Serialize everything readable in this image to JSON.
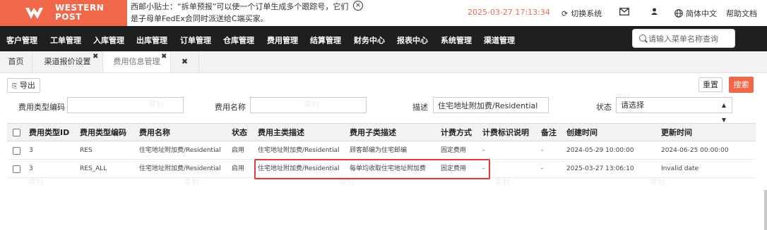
{
  "brand": {
    "line1": "WESTERN",
    "line2": "POST",
    "accent": "#f0674a"
  },
  "tip": {
    "text": "西邮小贴士：“拆单预报”可以使一个订单生成多个跟踪号，它们是子母单FedEx会同时派送给C端买家。"
  },
  "header": {
    "datetime": "2025-03-27 17:13:34",
    "switch_system": "切换系统",
    "language": "简体中文",
    "help": "帮助文档"
  },
  "nav": {
    "items": [
      "客户管理",
      "工单管理",
      "入库管理",
      "出库管理",
      "订单管理",
      "仓库管理",
      "费用管理",
      "结算管理",
      "财务中心",
      "报表中心",
      "系统管理",
      "渠道管理"
    ],
    "search_placeholder": "请输入菜单名称查询"
  },
  "tabs": [
    "首页",
    "渠道报价设置",
    "费用信息管理"
  ],
  "toolbar": {
    "export": "导出",
    "reset": "重置",
    "search": "搜索"
  },
  "filters": {
    "fee_type_code_label": "费用类型编码",
    "fee_type_code_value": "",
    "fee_name_label": "费用名称",
    "fee_name_value": "",
    "desc_label": "描述",
    "desc_value": "住宅地址附加费/Residential",
    "status_label": "状态",
    "status_value": "请选择"
  },
  "table": {
    "columns": [
      "费用类型ID",
      "费用类型编码",
      "费用名称",
      "状态",
      "费用主类描述",
      "费用子类描述",
      "计费方式",
      "计费标识说明",
      "备注",
      "创建时间",
      "更新时间"
    ],
    "rows": [
      [
        "3",
        "RES",
        "住宅地址附加费/Residential",
        "启用",
        "住宅地址附加费/Residential",
        "顾客邮编为住宅邮编",
        "固定费用",
        "-",
        "-",
        "2024-05-29 10:00:00",
        "2024-06-25 00:00:00"
      ],
      [
        "3",
        "RES_ALL",
        "住宅地址附加费/Residential",
        "启用",
        "住宅地址附加费/Residential",
        "每单均收取住宅地址附加费",
        "固定费用",
        "-",
        "-",
        "2025-03-27 13:06:10",
        "Invalid date"
      ]
    ]
  },
  "watermark": "零钊"
}
